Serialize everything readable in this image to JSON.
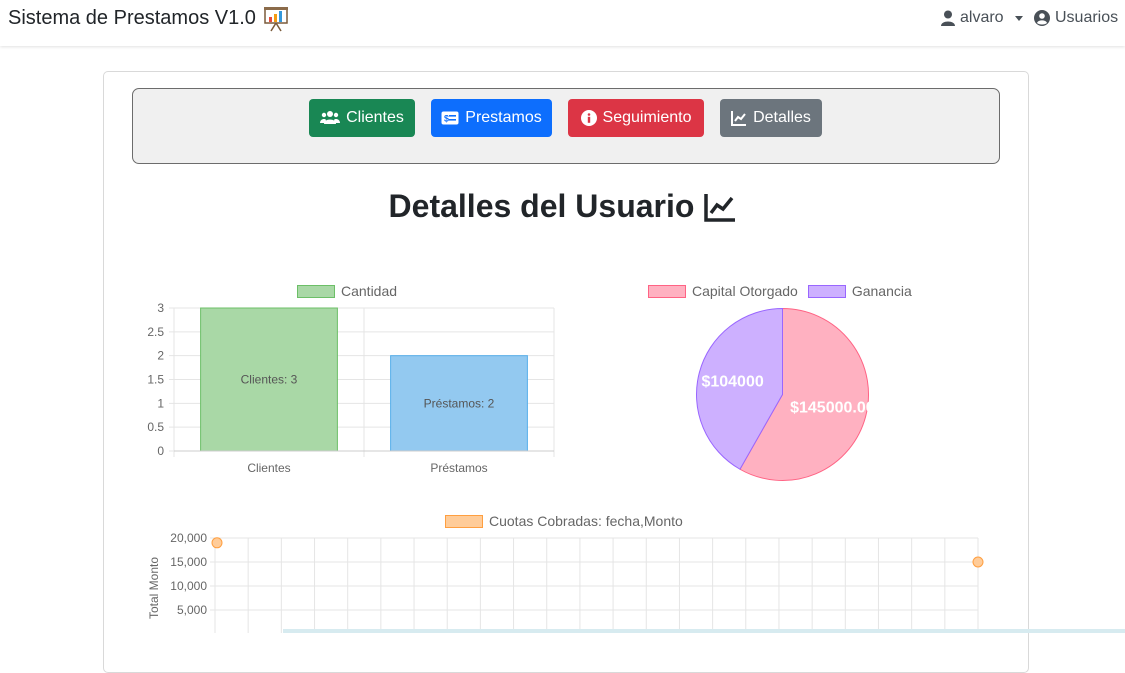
{
  "navbar": {
    "brand": "Sistema de Prestamos V1.0",
    "user": "alvaro",
    "users_link": "Usuarios"
  },
  "buttons": {
    "clientes": "Clientes",
    "prestamos": "Prestamos",
    "seguimiento": "Seguimiento",
    "detalles": "Detalles"
  },
  "page_title": "Detalles del Usuario",
  "colors": {
    "green": "#198754",
    "blue": "#0d6efd",
    "red": "#dc3545",
    "gray": "#6c757d"
  },
  "chart_data": [
    {
      "type": "bar",
      "legend": [
        "Cantidad"
      ],
      "categories": [
        "Clientes",
        "Préstamos"
      ],
      "values": [
        3,
        2
      ],
      "data_labels": [
        "Clientes: 3",
        "Préstamos: 2"
      ],
      "yticks": [
        "0",
        "0.5",
        "1",
        "1.5",
        "2",
        "2.5",
        "3"
      ],
      "ylim": [
        0,
        3
      ],
      "colors": [
        "#a9d8a6",
        "#93c9f0"
      ],
      "legend_placement": "top",
      "grid": true
    },
    {
      "type": "pie",
      "legend": [
        "Capital Otorgado",
        "Ganancia"
      ],
      "values": [
        145000,
        104000
      ],
      "data_labels": [
        "$145000.00",
        "$104000"
      ],
      "colors": [
        "#ffb1c1",
        "#cdb0ff"
      ],
      "legend_placement": "top"
    },
    {
      "type": "scatter",
      "legend": [
        "Cuotas Cobradas: fecha,Monto"
      ],
      "ylabel": "Total Monto",
      "yticks": [
        "20,000",
        "15,000",
        "10,000",
        "5,000"
      ],
      "ylim": [
        0,
        20000
      ],
      "points_y": [
        19000,
        15000
      ],
      "colors": [
        "#ffcc99"
      ],
      "legend_placement": "top",
      "grid": true
    }
  ]
}
